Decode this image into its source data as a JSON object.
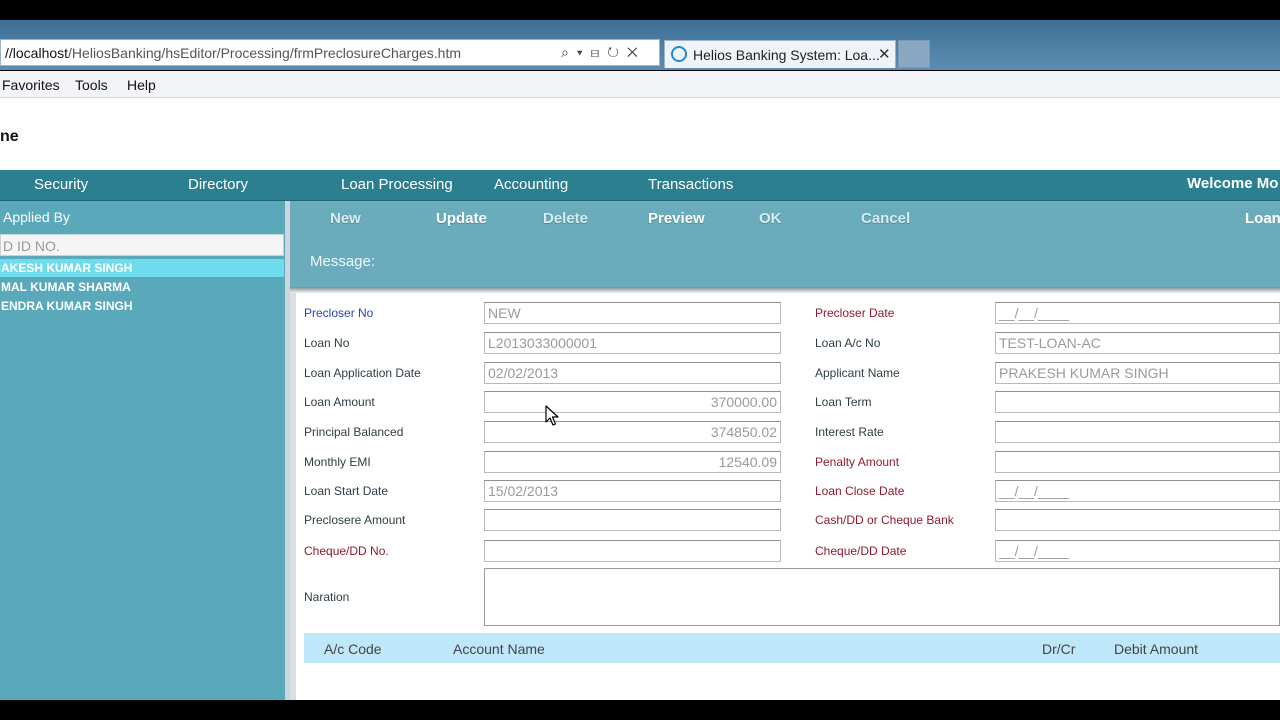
{
  "browser": {
    "address_host": "//localhost",
    "address_path": "/HeliosBanking/hsEditor/Processing/frmPreclosureCharges.htm",
    "address_icons": "⌕ ▾ ⊟ ↻ ✕",
    "tab_title": "Helios Banking System: Loa...",
    "tab_close": "✕"
  },
  "menubar": {
    "items": [
      "Favorites",
      "Tools",
      "Help"
    ]
  },
  "page": {
    "title_fragment": "ne"
  },
  "nav": {
    "items": [
      "Security",
      "Directory",
      "Loan Processing",
      "Accounting",
      "Transactions"
    ],
    "welcome": "Welcome Mo"
  },
  "left_panel": {
    "header": "Applied By",
    "search_placeholder": "D ID NO.",
    "rows": [
      {
        "label": "AKESH KUMAR SINGH",
        "selected": true
      },
      {
        "label": "MAL KUMAR SHARMA",
        "selected": false
      },
      {
        "label": "ENDRA KUMAR SINGH",
        "selected": false
      }
    ]
  },
  "toolbar": {
    "new": "New",
    "update": "Update",
    "delete": "Delete",
    "preview": "Preview",
    "ok": "OK",
    "cancel": "Cancel",
    "loan": "Loan",
    "message_label": "Message:"
  },
  "form": {
    "left": [
      {
        "label": "Precloser No",
        "value": "NEW"
      },
      {
        "label": "Loan No",
        "value": "L2013033000001"
      },
      {
        "label": "Loan Application Date",
        "value": "02/02/2013"
      },
      {
        "label": "Loan Amount",
        "value": "370000.00"
      },
      {
        "label": "Principal Balanced",
        "value": "374850.02"
      },
      {
        "label": "Monthly EMI",
        "value": "12540.09"
      },
      {
        "label": "Loan Start Date",
        "value": "15/02/2013"
      },
      {
        "label": "Preclosere Amount",
        "value": ""
      },
      {
        "label": "Cheque/DD No.",
        "value": ""
      }
    ],
    "right": [
      {
        "label": "Precloser Date",
        "value": "__/__/____"
      },
      {
        "label": "Loan A/c No",
        "value": "TEST-LOAN-AC"
      },
      {
        "label": "Applicant Name",
        "value": "PRAKESH KUMAR SINGH"
      },
      {
        "label": "Loan Term",
        "value": ""
      },
      {
        "label": "Interest Rate",
        "value": ""
      },
      {
        "label": "Penalty Amount",
        "value": ""
      },
      {
        "label": "Loan Close Date",
        "value": "__/__/____"
      },
      {
        "label": "Cash/DD or Cheque Bank",
        "value": ""
      },
      {
        "label": "Cheque/DD Date",
        "value": "__/__/____"
      }
    ],
    "naration_label": "Naration"
  },
  "grid": {
    "headers": [
      "A/c Code",
      "Account Name",
      "Dr/Cr",
      "Debit Amount"
    ]
  }
}
